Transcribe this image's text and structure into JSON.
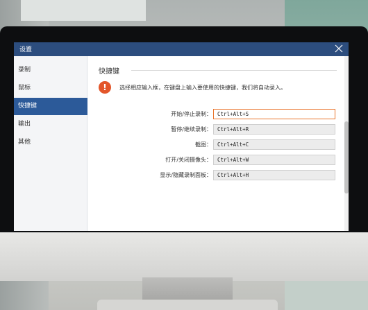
{
  "window": {
    "title": "设置",
    "close_icon": "close-icon",
    "accent_color": "#2c4d7e"
  },
  "sidebar": {
    "items": [
      {
        "label": "录制",
        "active": false
      },
      {
        "label": "鼠标",
        "active": false
      },
      {
        "label": "快捷键",
        "active": true
      },
      {
        "label": "输出",
        "active": false
      },
      {
        "label": "其他",
        "active": false
      }
    ]
  },
  "content": {
    "section_title": "快捷键",
    "info_icon": "alert-icon",
    "info_symbol": "!",
    "info_text": "选择相应输入框，在键盘上输入要使用的快捷键，我们将自动录入。",
    "shortcuts": [
      {
        "label": "开始/停止录制：",
        "value": "Ctrl+Alt+S",
        "focused": true
      },
      {
        "label": "暂停/继续录制：",
        "value": "Ctrl+Alt+R",
        "focused": false
      },
      {
        "label": "截图：",
        "value": "Ctrl+Alt+C",
        "focused": false
      },
      {
        "label": "打开/关闭摄像头：",
        "value": "Ctrl+Alt+W",
        "focused": false
      },
      {
        "label": "显示/隐藏录制面板：",
        "value": "Ctrl+Alt+H",
        "focused": false
      }
    ]
  }
}
